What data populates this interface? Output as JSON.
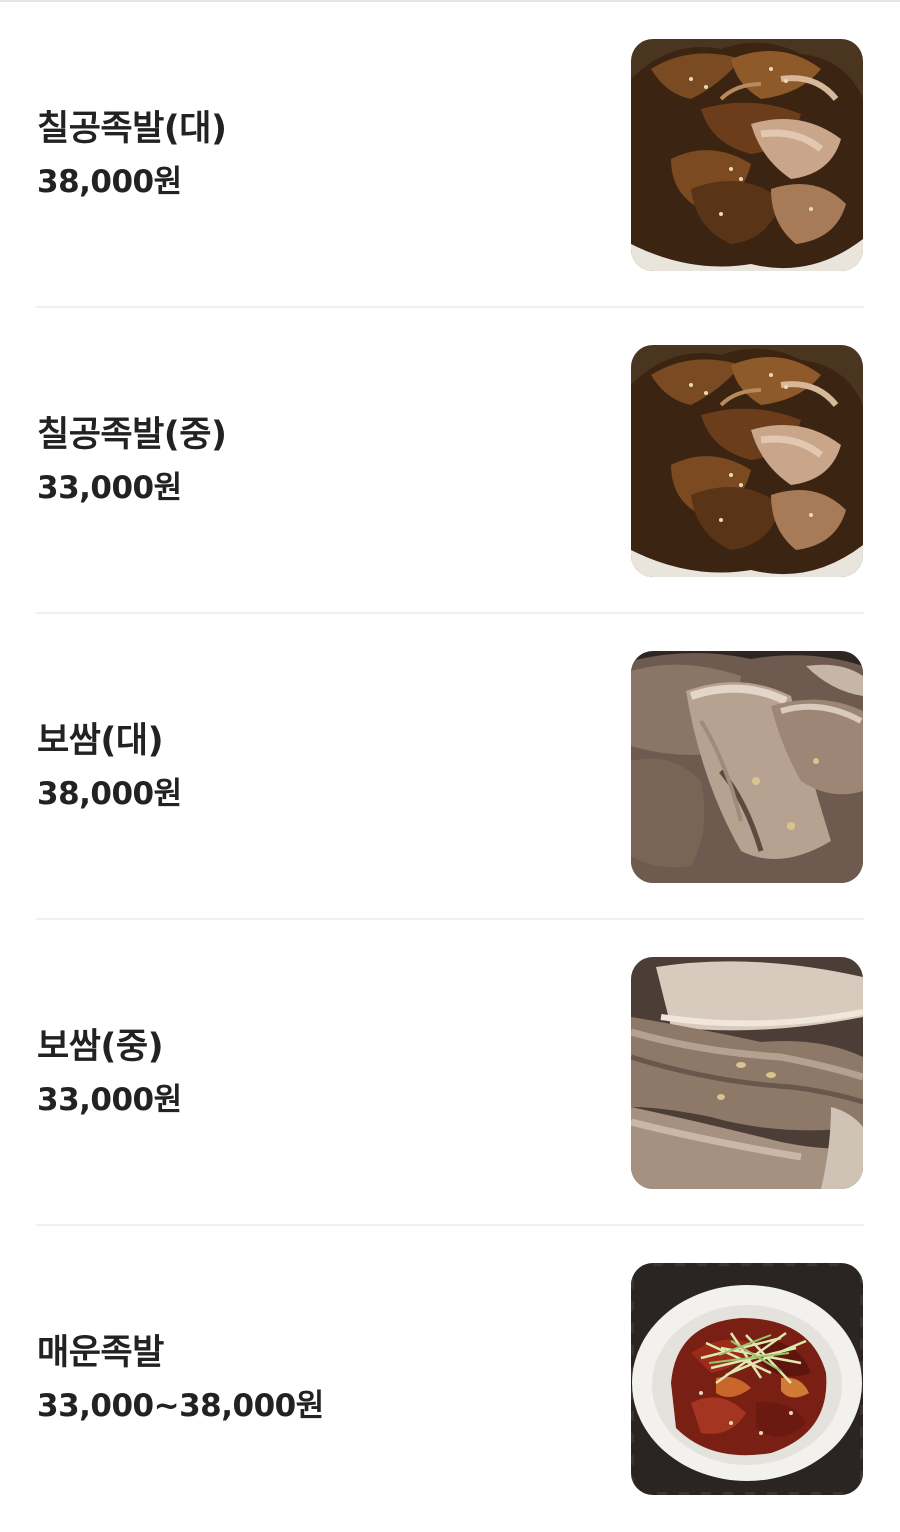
{
  "menu": {
    "items": [
      {
        "name": "칠공족발(대)",
        "price": "38,000원",
        "photo": "jokbal-photo"
      },
      {
        "name": "칠공족발(중)",
        "price": "33,000원",
        "photo": "jokbal-photo"
      },
      {
        "name": "보쌈(대)",
        "price": "38,000원",
        "photo": "bossam-photo"
      },
      {
        "name": "보쌈(중)",
        "price": "33,000원",
        "photo": "bossam-photo"
      },
      {
        "name": "매운족발",
        "price": "33,000~38,000원",
        "photo": "spicy-jokbal-photo"
      }
    ]
  },
  "colors": {
    "text": "#222222",
    "divider": "#f0f0f0",
    "background": "#ffffff"
  }
}
